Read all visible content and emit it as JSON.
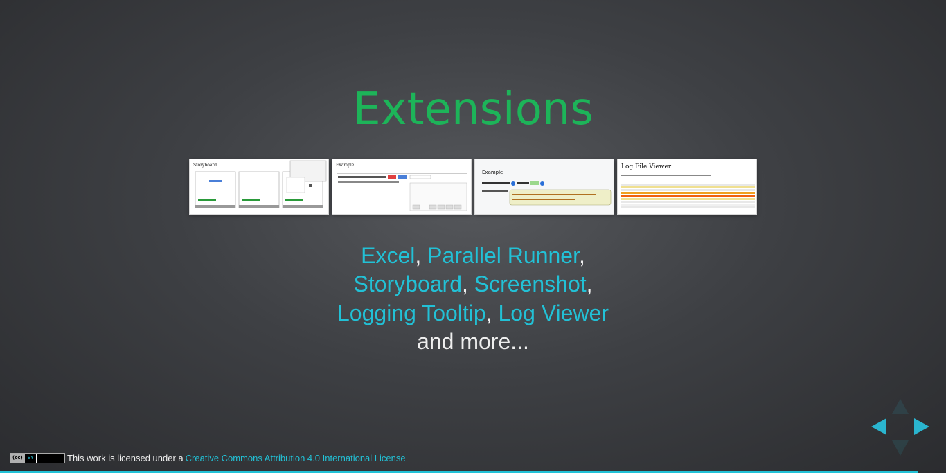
{
  "slide": {
    "title": "Extensions",
    "thumbnails": [
      {
        "label": "Storyboard",
        "icon": "storyboard-thumbnail"
      },
      {
        "label": "Example",
        "icon": "screenshot-thumbnail"
      },
      {
        "label": "Example",
        "icon": "logging-tooltip-thumbnail"
      },
      {
        "label": "Log File Viewer",
        "icon": "log-viewer-thumbnail"
      }
    ],
    "links": {
      "excel": "Excel",
      "parallel_runner": "Parallel Runner",
      "storyboard": "Storyboard",
      "screenshot": "Screenshot",
      "logging_tooltip": "Logging Tooltip",
      "log_viewer": "Log Viewer",
      "sep": ",",
      "more": "and more..."
    }
  },
  "license": {
    "badge_cc": "(cc)",
    "badge_by": "BY",
    "prefix": "This work is licensed under a",
    "link": "Creative Commons Attribution 4.0 International License"
  },
  "controls": [
    "nav-left-icon",
    "nav-right-icon",
    "nav-up-icon",
    "nav-down-icon"
  ],
  "colors": {
    "title": "#1db459",
    "link": "#22c1d6",
    "text": "#eeeeee",
    "background": "#3e4044"
  }
}
